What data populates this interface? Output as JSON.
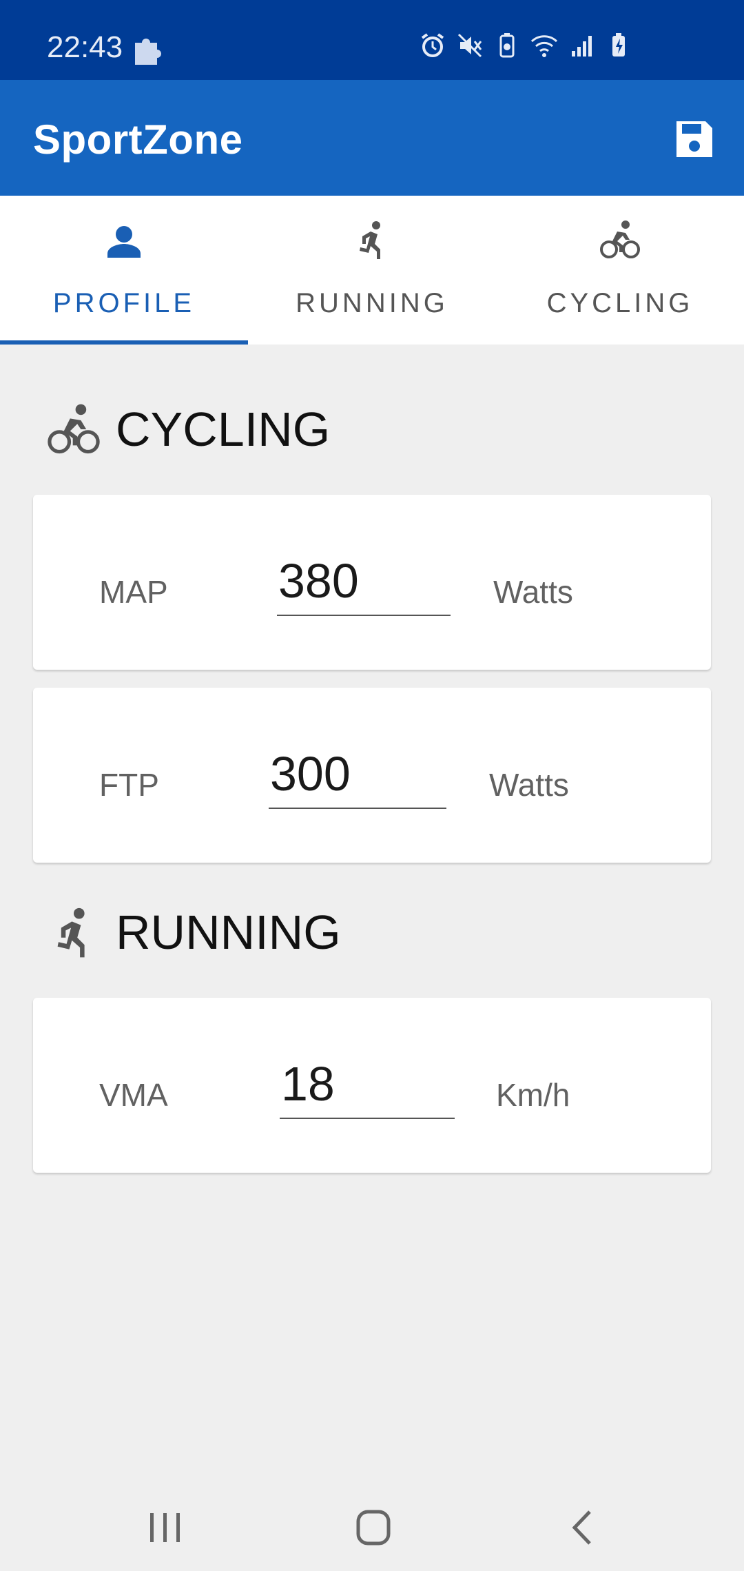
{
  "status_bar": {
    "time": "22:43",
    "icons": [
      "puzzle-icon",
      "alarm-icon",
      "mute-icon",
      "battery-saver-icon",
      "wifi-icon",
      "signal-icon",
      "battery-charging-icon"
    ]
  },
  "app_bar": {
    "title": "SportZone",
    "save_icon": "save-icon",
    "color": "#1565c0"
  },
  "tabs": [
    {
      "label": "PROFILE",
      "icon": "person-icon",
      "active": true
    },
    {
      "label": "RUNNING",
      "icon": "running-icon",
      "active": false
    },
    {
      "label": "CYCLING",
      "icon": "bike-icon",
      "active": false
    }
  ],
  "sections": {
    "cycling": {
      "title": "CYCLING",
      "icon": "bike-icon",
      "fields": [
        {
          "label": "MAP",
          "value": "380",
          "unit": "Watts"
        },
        {
          "label": "FTP",
          "value": "300",
          "unit": "Watts"
        }
      ]
    },
    "running": {
      "title": "RUNNING",
      "icon": "running-icon",
      "fields": [
        {
          "label": "VMA",
          "value": "18",
          "unit": "Km/h"
        }
      ]
    }
  },
  "nav_bar": {
    "buttons": [
      "recent-apps-icon",
      "home-icon",
      "back-icon"
    ]
  },
  "colors": {
    "status_bar": "#003c96",
    "accent": "#1a5fb4",
    "background": "#efefef"
  }
}
